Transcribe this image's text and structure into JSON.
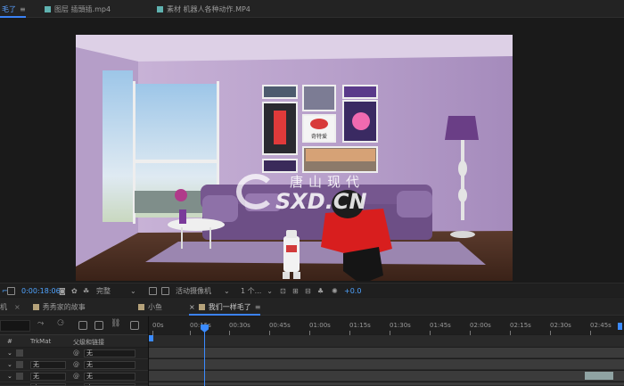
{
  "top_tabs": [
    {
      "label": "毛了",
      "active": true
    },
    {
      "label": "图层 插頭插.mp4",
      "active": false
    },
    {
      "label": "素材 机器人各种动作.MP4",
      "active": false
    }
  ],
  "composition": {
    "watermark_cn": "唐山现代",
    "watermark_en": "sxd.cn",
    "picture_frame_text": "奇特爱"
  },
  "viewer_controls": {
    "timecode": "0:00:18:06",
    "resolution": "完整",
    "camera": "活动摄像机",
    "views": "1 个...",
    "exposure": "+0.0"
  },
  "timeline_tabs": [
    {
      "label": "机",
      "active": false
    },
    {
      "label": "秀秀家的故事",
      "active": false
    },
    {
      "label": "小鱼",
      "active": false
    },
    {
      "label": "我们一样毛了",
      "active": true
    }
  ],
  "ruler_ticks": [
    "00s",
    "00:15s",
    "00:30s",
    "00:45s",
    "01:00s",
    "01:15s",
    "01:30s",
    "01:45s",
    "02:00s",
    "02:15s",
    "02:30s",
    "02:45s"
  ],
  "layer_header": {
    "trkmat": "TrkMat",
    "parent": "父级和链接"
  },
  "layers": [
    {
      "trkmat": "",
      "parent": "无"
    },
    {
      "trkmat": "无",
      "parent": "无"
    },
    {
      "trkmat": "无",
      "parent": "无"
    },
    {
      "trkmat": "无",
      "parent": "无"
    }
  ],
  "colors": {
    "accent": "#3b82f6",
    "timecode": "#4fa3ff",
    "wall": "#b9a3cb",
    "sofa": "#6d4f86"
  }
}
